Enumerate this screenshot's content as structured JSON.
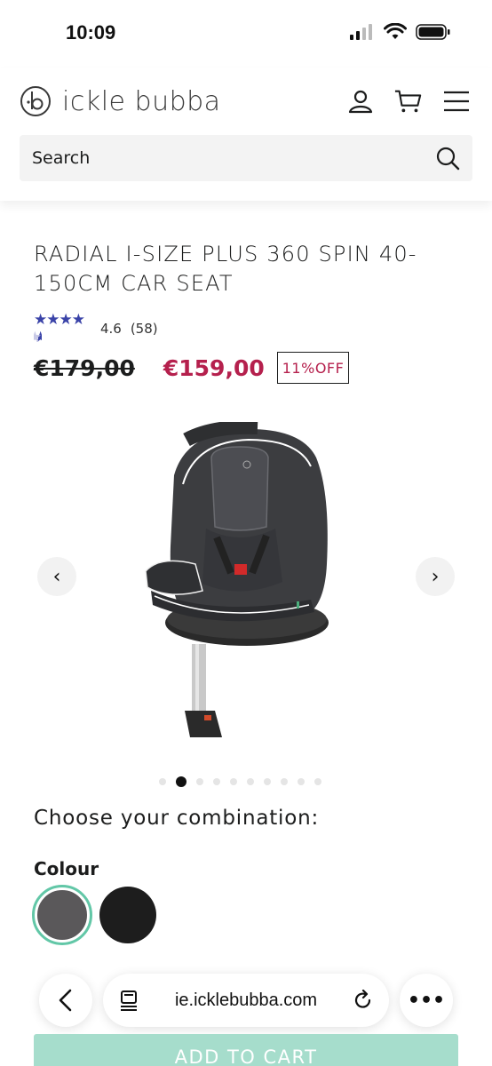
{
  "status_bar": {
    "time": "10:09"
  },
  "header": {
    "brand": "ickle bubba",
    "search": {
      "placeholder": "Search"
    }
  },
  "product": {
    "title": "RADIAL I-SIZE PLUS 360 SPIN 40-150CM CAR SEAT",
    "rating": {
      "stars": 4.6,
      "value": "4.6",
      "count": "(58)"
    },
    "old_price": "€179,00",
    "new_price": "€159,00",
    "discount": "11%OFF"
  },
  "gallery": {
    "image_count": 10,
    "active_index": 1
  },
  "options": {
    "heading": "Choose your combination:",
    "colour_label": "Colour",
    "swatches": [
      {
        "name": "grey",
        "color": "#5a585a",
        "selected": true
      },
      {
        "name": "black",
        "color": "#1d1d1d",
        "selected": false
      }
    ]
  },
  "browser": {
    "url": "ie.icklebubba.com"
  },
  "cta": {
    "add_to_cart": "ADD TO CART"
  },
  "colors": {
    "accent": "#b5204d",
    "selected_ring": "#62c7a7",
    "cart_button": "#a6ddcc",
    "star": "#3a43a8"
  }
}
